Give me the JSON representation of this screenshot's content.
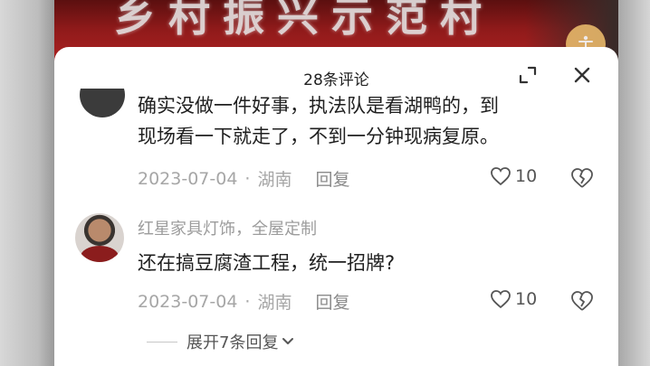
{
  "video_banner_text": "乡村振兴示范村",
  "sheet": {
    "title": "28条评论"
  },
  "comments": [
    {
      "text_line1": "确实没做一件好事，执法队是看湖鸭的，到",
      "text_line2": "现场看一下就走了，不到一分钟现病复原。",
      "date": "2023-07-04",
      "separator": "·",
      "location": "湖南",
      "reply_label": "回复",
      "likes": "10"
    },
    {
      "username": "红星家具灯饰，全屋定制",
      "text": "还在搞豆腐渣工程，统一招牌?",
      "date": "2023-07-04",
      "separator": "·",
      "location": "湖南",
      "reply_label": "回复",
      "likes": "10",
      "expand_label": "展开7条回复"
    }
  ],
  "icons": {
    "fab": "accessibility-icon",
    "expand": "expand-icon",
    "close": "close-icon",
    "like": "heart-icon",
    "dislike": "broken-heart-icon",
    "chevron": "chevron-down-icon"
  },
  "colors": {
    "accent_fab": "#e7b86a",
    "sheet_bg": "#ffffff",
    "meta_text": "#a6a6a6"
  }
}
